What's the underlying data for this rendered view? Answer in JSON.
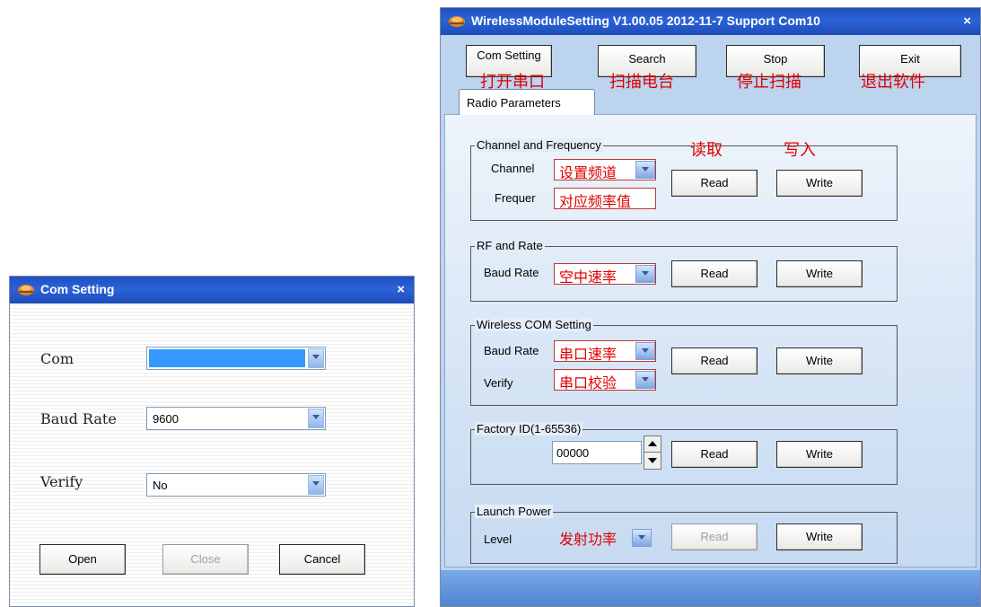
{
  "com_dialog": {
    "title": "Com Setting",
    "close_glyph": "×",
    "com_label": "Com",
    "com_value": "",
    "baud_label": "Baud Rate",
    "baud_value": "9600",
    "verify_label": "Verify",
    "verify_value": "No",
    "open_label": "Open",
    "close_label": "Close",
    "cancel_label": "Cancel"
  },
  "main": {
    "title": "WirelessModuleSetting V1.00.05 2012-11-7 Support Com10",
    "close_glyph": "×",
    "toolbar": [
      {
        "label": "Com Setting",
        "note": "打开串口"
      },
      {
        "label": "Search",
        "note": "扫描电台"
      },
      {
        "label": "Stop",
        "note": "停止扫描"
      },
      {
        "label": "Exit",
        "note": "退出软件"
      }
    ],
    "tab_label": "Radio Parameters",
    "read_note": "读取",
    "write_note": "写入",
    "read_label": "Read",
    "write_label": "Write",
    "channel_group": {
      "title": "Channel and Frequency",
      "channel_label": "Channel",
      "channel_value": "设置频道",
      "freq_label": "Frequer",
      "freq_value": "对应频率值"
    },
    "rf_group": {
      "title": "RF and Rate",
      "baud_label": "Baud Rate",
      "baud_value": "空中速率"
    },
    "wcom_group": {
      "title": "Wireless COM Setting",
      "baud_label": "Baud Rate",
      "baud_value": "串口速率",
      "verify_label": "Verify",
      "verify_value": "串口校验"
    },
    "factory_group": {
      "title": "Factory ID(1-65536)",
      "value": "00000"
    },
    "power_group": {
      "title": "Launch  Power",
      "level_label": "Level",
      "level_value": "发射功率"
    }
  },
  "colors": {
    "title_bar": "#2b63d8",
    "annotation_red": "#e00000",
    "selection_blue": "#3399ff"
  }
}
